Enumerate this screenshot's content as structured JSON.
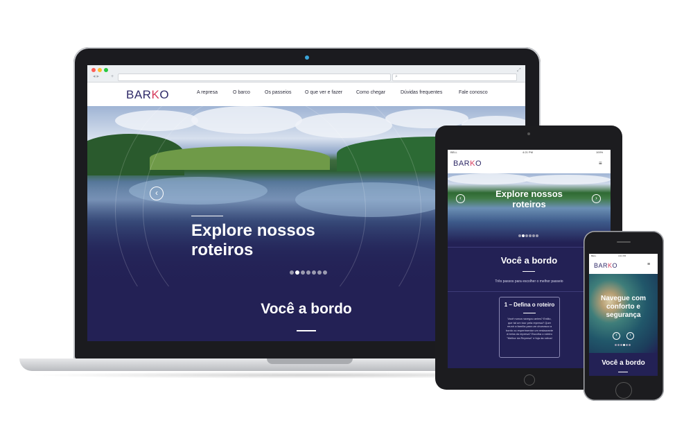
{
  "site": {
    "logo_main": "BAR",
    "logo_accent": "K",
    "logo_end": "O"
  },
  "nav": {
    "items": [
      {
        "label": "A represa"
      },
      {
        "label": "O barco"
      },
      {
        "label": "Os passeios"
      },
      {
        "label": "O que ver e fazer"
      },
      {
        "label": "Como chegar"
      },
      {
        "label": "Dúvidas frequentes"
      },
      {
        "label": "Fale conosco"
      }
    ]
  },
  "hero": {
    "title_line1": "Explore nossos",
    "title_line2": "roteiros",
    "prev_arrow": "‹",
    "next_arrow": "›",
    "bullets": 7,
    "active_bullet": 2
  },
  "section": {
    "title": "Você a bordo",
    "subtitle": "Três passos para escolher o melhor passeio"
  },
  "card": {
    "title": "1 – Defina o roteiro",
    "text": "Você nunca navegou antes? Então, que tal um tour pela represa? Quer reunir a família para um churrasco a bordo ou experimentar um restaurante à beira da represa? Escolha o roteiro \"Melhor da Represa\" e fuja da rotina!"
  },
  "tablet_status": {
    "carrier": "BELL",
    "time": "4:21 PM",
    "battery": "100%"
  },
  "phone_status": {
    "carrier": "BELL",
    "time": "4:21 PM"
  },
  "phone_hero": {
    "title": "Navegue com conforto e segurança"
  },
  "menu_icon": "hamburger-icon"
}
